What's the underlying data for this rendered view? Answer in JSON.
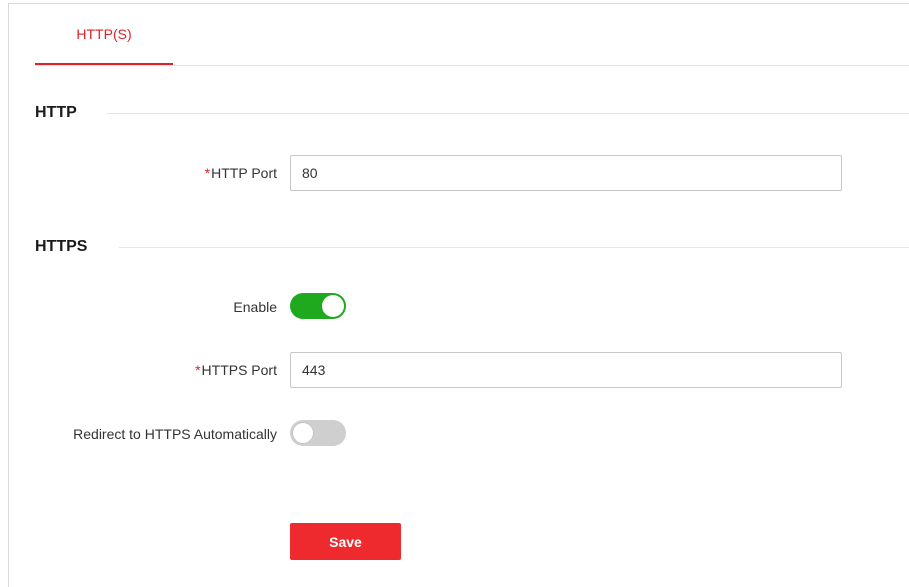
{
  "tabs": [
    {
      "label": "HTTP(S)",
      "active": true
    }
  ],
  "http_section": {
    "title": "HTTP",
    "port_label": "HTTP Port",
    "port_required_mark": "*",
    "port_value": "80"
  },
  "https_section": {
    "title": "HTTPS",
    "enable_label": "Enable",
    "enable_on": true,
    "port_label": "HTTPS Port",
    "port_required_mark": "*",
    "port_value": "443",
    "redirect_label": "Redirect to HTTPS Automatically",
    "redirect_on": false
  },
  "actions": {
    "save_label": "Save"
  },
  "colors": {
    "accent": "#e02128",
    "save_button": "#ee2a2f",
    "toggle_on": "#1ea91e",
    "toggle_off": "#cfcfcf"
  }
}
